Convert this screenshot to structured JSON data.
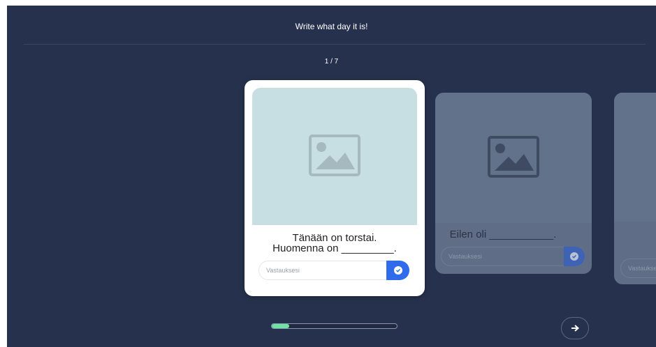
{
  "header": {
    "title": "Write what day it is!",
    "counter": "1 / 7"
  },
  "cards": {
    "active": {
      "prompt_line1": "Tänään on torstai.",
      "prompt_line2": "Huomenna on _________.",
      "answer_placeholder": "Vastauksesi"
    },
    "next": {
      "prompt": "Eilen oli ___________.",
      "answer_placeholder": "Vastauksesi"
    },
    "far": {
      "answer_placeholder": "Vastauksesi"
    }
  },
  "progress": {
    "current": 1,
    "total": 7,
    "fraction": 0.14
  },
  "icons": {
    "image_placeholder": "image-placeholder-icon",
    "submit": "check-circle-icon",
    "next": "arrow-right-icon"
  },
  "colors": {
    "background": "#26324d",
    "accent": "#2f6bea",
    "progress": "#6fe3a3"
  }
}
